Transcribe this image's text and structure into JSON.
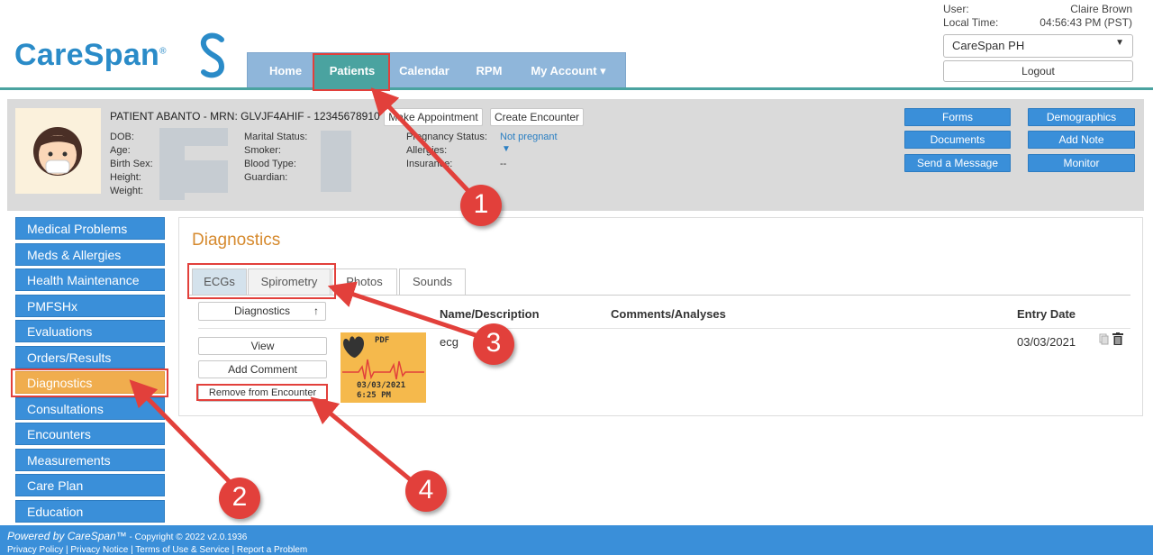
{
  "app": {
    "logo_text": "CareSpan",
    "logo_mark": "®"
  },
  "nav": {
    "items": [
      "Home",
      "Patients",
      "Calendar",
      "RPM",
      "My Account ▾"
    ]
  },
  "user": {
    "user_label": "User:",
    "user_name": "Claire Brown",
    "time_label": "Local Time:",
    "time_value": "04:56:43 PM (PST)",
    "site": "CareSpan PH",
    "logout": "Logout"
  },
  "patient": {
    "title": "PATIENT ABANTO - MRN: GLVJF4AHIF - 12345678910",
    "make_appointment": "Make Appointment",
    "create_encounter": "Create Encounter",
    "labels_left": [
      "DOB:",
      "Age:",
      "Birth Sex:",
      "Height:",
      "Weight:"
    ],
    "labels_mid": [
      "Marital Status:",
      "Smoker:",
      "Blood Type:",
      "Guardian:"
    ],
    "labels_right": [
      "Pregnancy Status:",
      "Allergies:",
      "Insurance:"
    ],
    "pregnancy_value": "Not pregnant",
    "insurance_value": "--",
    "actions": [
      "Forms",
      "Demographics",
      "Documents",
      "Add Note",
      "Send a Message",
      "Monitor"
    ]
  },
  "sidebar": {
    "items": [
      "Medical Problems",
      "Meds & Allergies",
      "Health Maintenance",
      "PMFSHx",
      "Evaluations",
      "Orders/Results",
      "Diagnostics",
      "Consultations",
      "Encounters",
      "Measurements",
      "Care Plan",
      "Education"
    ],
    "active": "Diagnostics",
    "active_color": "#f0ad4e"
  },
  "main": {
    "title": "Diagnostics",
    "tabs": [
      "ECGs",
      "Spirometry",
      "Photos",
      "Sounds"
    ],
    "sort_label": "Diagnostics",
    "sort_arrow": "↑",
    "columns": [
      "Name/Description",
      "Comments/Analyses",
      "Entry Date"
    ],
    "row": {
      "buttons": [
        "View",
        "Add Comment",
        "Remove from Encounter"
      ],
      "thumb_pdf": "PDF",
      "thumb_date": "03/03/2021",
      "thumb_time": "6:25 PM",
      "name": "ecg",
      "date": "03/03/2021"
    }
  },
  "footer": {
    "powered": "Powered by CareSpan™",
    "copyright": " - Copyright © 2022 v2.0.1936",
    "links": "Privacy Policy | Privacy Notice | Terms of Use & Service | Report a Problem"
  },
  "annotations": [
    "1",
    "2",
    "3",
    "4"
  ],
  "colors": {
    "accent_blue": "#3a8fd9",
    "teal": "#4aa3a0",
    "annotation_red": "#e2403b",
    "orange_title": "#d68a2e"
  }
}
